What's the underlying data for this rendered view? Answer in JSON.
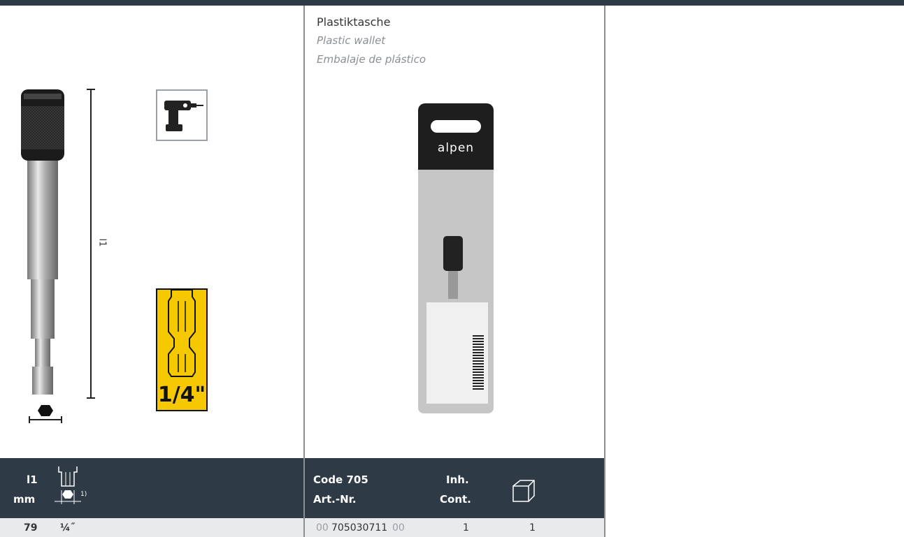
{
  "left_panel": {
    "dimension_label": "l1",
    "shank_label": "1/4\""
  },
  "packaging": {
    "title": "Plastiktasche",
    "subtitle_en": "Plastic wallet",
    "subtitle_es": "Embalaje de plástico",
    "brand": "alpen"
  },
  "table_left": {
    "col1_header_line1": "l1",
    "col1_header_line2": "mm",
    "footnote": "1)",
    "row": {
      "l1": "79",
      "hex": "¼˝"
    }
  },
  "table_mid": {
    "code_header": "Code 705",
    "artnr_header": "Art.-Nr.",
    "inh_header": "Inh.",
    "cont_header": "Cont.",
    "row": {
      "prefix": "00",
      "artnr": "705030711",
      "suffix": "00",
      "inh": "1",
      "box": "1"
    }
  },
  "colors": {
    "header_bg": "#2e3a46",
    "row_bg": "#e9eaec",
    "hex_yellow": "#f6c800"
  }
}
